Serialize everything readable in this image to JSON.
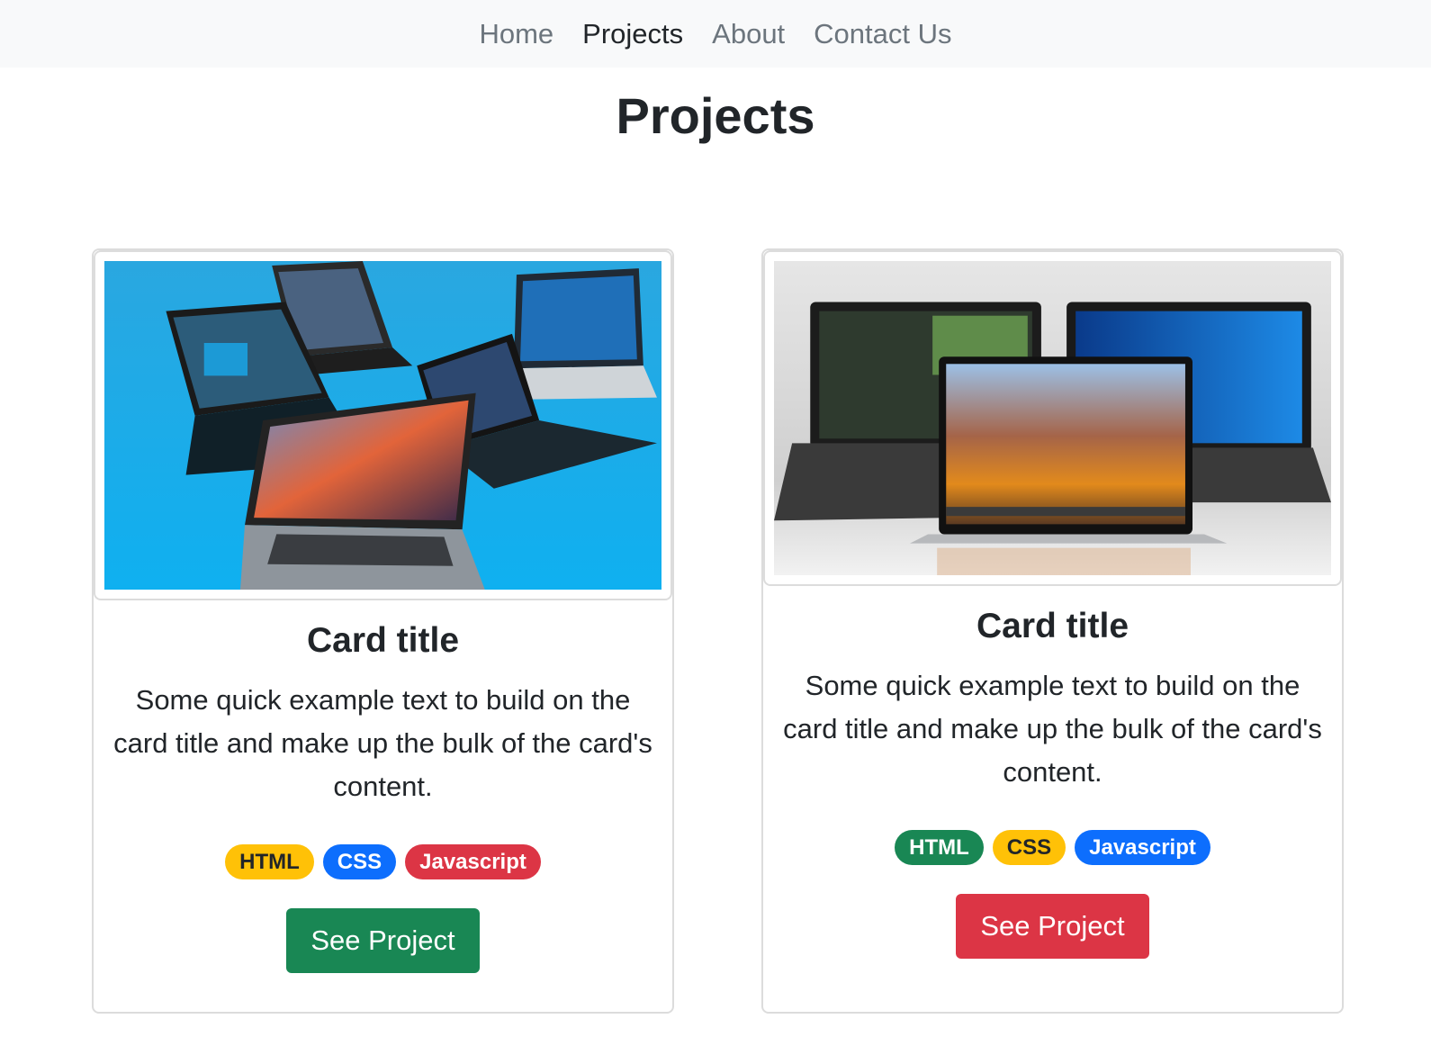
{
  "nav": {
    "items": [
      {
        "label": "Home",
        "active": false
      },
      {
        "label": "Projects",
        "active": true
      },
      {
        "label": "About",
        "active": false
      },
      {
        "label": "Contact Us",
        "active": false
      }
    ]
  },
  "page": {
    "title": "Projects"
  },
  "cards": [
    {
      "image": "laptops-on-blue-background",
      "title": "Card title",
      "text": "Some quick example text to build on the card title and make up the bulk of the card's content.",
      "badges": [
        {
          "label": "HTML",
          "color": "#ffc107"
        },
        {
          "label": "CSS",
          "color": "#0d6efd"
        },
        {
          "label": "Javascript",
          "color": "#dc3545"
        }
      ],
      "button": {
        "label": "See Project",
        "color": "#198754"
      }
    },
    {
      "image": "laptops-on-grey-background",
      "title": "Card title",
      "text": "Some quick example text to build on the card title and make up the bulk of the card's content.",
      "badges": [
        {
          "label": "HTML",
          "color": "#198754"
        },
        {
          "label": "CSS",
          "color": "#ffc107"
        },
        {
          "label": "Javascript",
          "color": "#0d6efd"
        }
      ],
      "button": {
        "label": "See Project",
        "color": "#dc3545"
      }
    }
  ]
}
